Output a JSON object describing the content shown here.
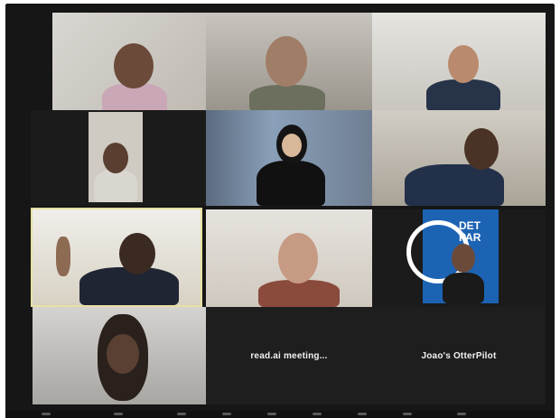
{
  "meeting": {
    "tiles": [
      {
        "name": "",
        "center_text": ""
      },
      {
        "name": "",
        "center_text": ""
      },
      {
        "name": "",
        "center_text": ""
      },
      {
        "name": "",
        "center_text": ""
      },
      {
        "name": "",
        "center_text": ""
      },
      {
        "name": "",
        "center_text": ""
      },
      {
        "name": "",
        "center_text": ""
      },
      {
        "name": "",
        "center_text": ""
      },
      {
        "name": "",
        "center_text": "",
        "logo_text": "DET\nPAR"
      },
      {
        "name": "",
        "center_text": ""
      },
      {
        "name": "",
        "center_text": "read.ai meeting..."
      },
      {
        "name": "",
        "center_text": "Joao's OtterPilot"
      }
    ],
    "active_speaker_index": 6
  },
  "colors": {
    "frame": "#161616",
    "active_outline": "#e8e0a0",
    "logo_blue": "#1c63b4"
  }
}
